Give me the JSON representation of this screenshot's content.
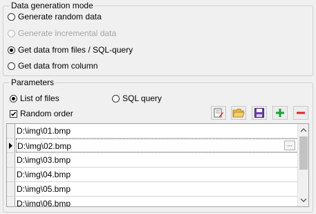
{
  "mode_group": {
    "legend": "Data generation mode",
    "options": [
      {
        "label": "Generate random data",
        "checked": false,
        "disabled": false
      },
      {
        "label": "Generate incremental data",
        "checked": false,
        "disabled": true
      },
      {
        "label": "Get data from files / SQL-query",
        "checked": true,
        "disabled": false
      },
      {
        "label": "Get data from column",
        "checked": false,
        "disabled": false
      }
    ]
  },
  "params_group": {
    "legend": "Parameters",
    "list_of_files_label": "List of files",
    "sql_query_label": "SQL query",
    "random_order_label": "Random order",
    "random_order_checked": true,
    "source_selected": "List of files"
  },
  "toolbar": {
    "icons": [
      "edit-icon",
      "open-folder-icon",
      "save-icon",
      "add-icon",
      "remove-icon"
    ]
  },
  "files": [
    "D:\\img\\01.bmp",
    "D:\\img\\02.bmp",
    "D:\\img\\03.bmp",
    "D:\\img\\04.bmp",
    "D:\\img\\05.bmp",
    "D:\\img\\06.bmp"
  ],
  "selected_file_index": 1,
  "ellipsis_label": "...",
  "colors": {
    "add": "#1e9e3a",
    "remove": "#d9262f",
    "folder": "#e8b84a",
    "save": "#6a3fb0"
  }
}
